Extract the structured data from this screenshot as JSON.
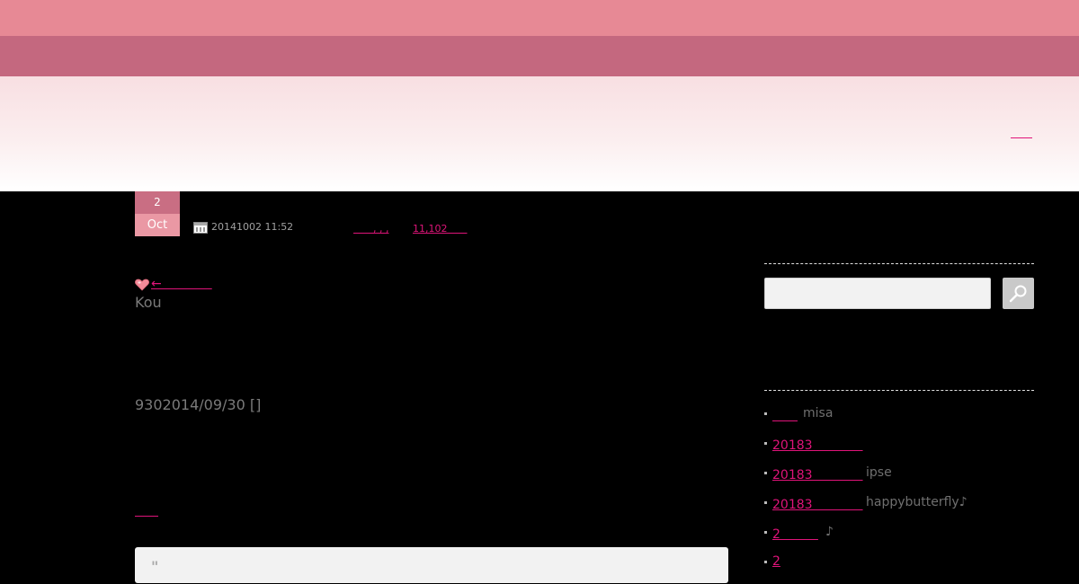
{
  "header": {
    "link_label": "　　"
  },
  "post": {
    "date_badge": {
      "day": "2",
      "month": "Oct"
    },
    "meta": {
      "date": "20141002 11:52",
      "categories": "　　, , ,",
      "comments": "11,102　　"
    },
    "link_text": "←　　　　",
    "author": "Kou",
    "date_line": "9302014/09/30 []",
    "more_link": "　　",
    "quote_mark": "\""
  },
  "sidebar": {
    "search": {
      "placeholder": ""
    },
    "recent_comments": [
      {
        "link": "　　",
        "author": "misa"
      },
      {
        "link": "20183　　　　",
        "author": ""
      },
      {
        "link": "20183　　　　",
        "author": "ipse"
      },
      {
        "link": "20183　　　　",
        "author": "happybutterfly♪"
      },
      {
        "link": "2　　　",
        "author": "♪"
      },
      {
        "link": "2",
        "author": ""
      }
    ]
  },
  "colors": {
    "top_bar": "#e78995",
    "nav_bar": "#c4687f",
    "link": "#e0147a",
    "date_day_bg": "#c96e83",
    "date_month_bg": "#ea98a4"
  },
  "icons": [
    "calendar-icon",
    "heart-icon",
    "search-icon"
  ]
}
